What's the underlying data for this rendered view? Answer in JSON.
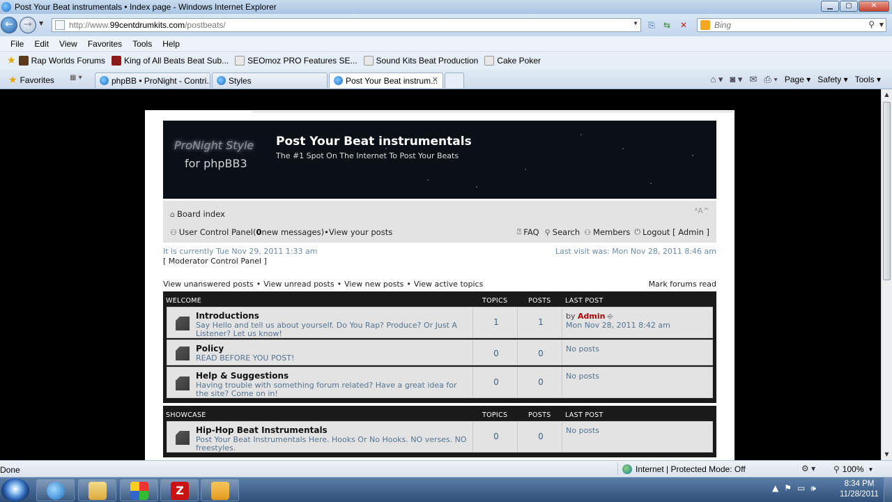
{
  "window": {
    "title": "Post Your Beat instrumentals • Index page - Windows Internet Explorer"
  },
  "address": {
    "url_prefix": "http://www.",
    "url_domain": "99centdrumkits.com",
    "url_path": "/postbeats/",
    "search_placeholder": "Bing"
  },
  "menu": [
    "File",
    "Edit",
    "View",
    "Favorites",
    "Tools",
    "Help"
  ],
  "favorites_bar": {
    "favorites_label": "Favorites",
    "links": [
      {
        "label": "Rap Worlds Forums",
        "color": "#5a3a1a"
      },
      {
        "label": "King of All Beats Beat Sub...",
        "color": "#8a1a1a"
      },
      {
        "label": "SEOmoz PRO Features  SE...",
        "color": "#e8e8e8"
      },
      {
        "label": "Sound Kits  Beat Production",
        "color": "#e8e8e8"
      },
      {
        "label": "Cake Poker",
        "color": "#e8e8e8"
      }
    ]
  },
  "tabs": [
    {
      "label": "phpBB • ProNight - Contri...",
      "active": false
    },
    {
      "label": "Styles",
      "active": false
    },
    {
      "label": "Post Your Beat instrum...",
      "active": true
    }
  ],
  "command_bar": {
    "page": "Page ▾",
    "safety": "Safety ▾",
    "tools": "Tools ▾"
  },
  "forum": {
    "logo_line1": "ProNight Style",
    "logo_line2": "for phpBB3",
    "site_name": "Post Your Beat instrumentals",
    "site_desc": "The #1 Spot On The Internet To Post Your Beats",
    "breadcrumb": "Board index",
    "ucp": "User Control Panel",
    "ucp_open": " (",
    "new_count": "0",
    "new_messages": " new messages)",
    "bullet": " • ",
    "view_posts": "View your posts",
    "faq": "FAQ",
    "search": "Search",
    "members": "Members",
    "logout": "Logout [ Admin ]",
    "current_time": "It is currently Tue Nov 29, 2011 1:33 am",
    "last_visit": "Last visit was: Mon Nov 28, 2011 8:46 am",
    "mcp": "[ Moderator Control Panel ]",
    "view_links": [
      "View unanswered posts",
      "View unread posts",
      "View new posts",
      "View active topics"
    ],
    "mark_read": "Mark forums read",
    "col_topics": "TOPICS",
    "col_posts": "POSTS",
    "col_lastpost": "LAST POST",
    "categories": [
      {
        "name": "WELCOME",
        "forums": [
          {
            "name": "Introductions",
            "desc": "Say Hello and tell us about yourself. Do You Rap? Produce? Or Just A Listener? Let us know!",
            "topics": "1",
            "posts": "1",
            "last_by": "by ",
            "last_user": "Admin",
            "last_date": "Mon Nov 28, 2011 8:42 am",
            "no_posts": ""
          },
          {
            "name": "Policy",
            "desc": "READ BEFORE YOU POST!",
            "topics": "0",
            "posts": "0",
            "last_by": "",
            "last_user": "",
            "last_date": "",
            "no_posts": "No posts"
          },
          {
            "name": "Help & Suggestions",
            "desc": "Having trouble with something forum related? Have a great idea for the site? Come on in!",
            "topics": "0",
            "posts": "0",
            "last_by": "",
            "last_user": "",
            "last_date": "",
            "no_posts": "No posts"
          }
        ]
      },
      {
        "name": "SHOWCASE",
        "forums": [
          {
            "name": "Hip-Hop Beat Instrumentals",
            "desc": "Post Your Beat Instrumentals Here. Hooks Or No Hooks. NO verses. NO freestyles.",
            "topics": "0",
            "posts": "0",
            "last_by": "",
            "last_user": "",
            "last_date": "",
            "no_posts": "No posts"
          }
        ]
      }
    ]
  },
  "status": {
    "text": "Done",
    "zone": "Internet | Protected Mode: Off",
    "zoom": "100%"
  },
  "clock": {
    "time": "8:34 PM",
    "date": "11/28/2011"
  }
}
